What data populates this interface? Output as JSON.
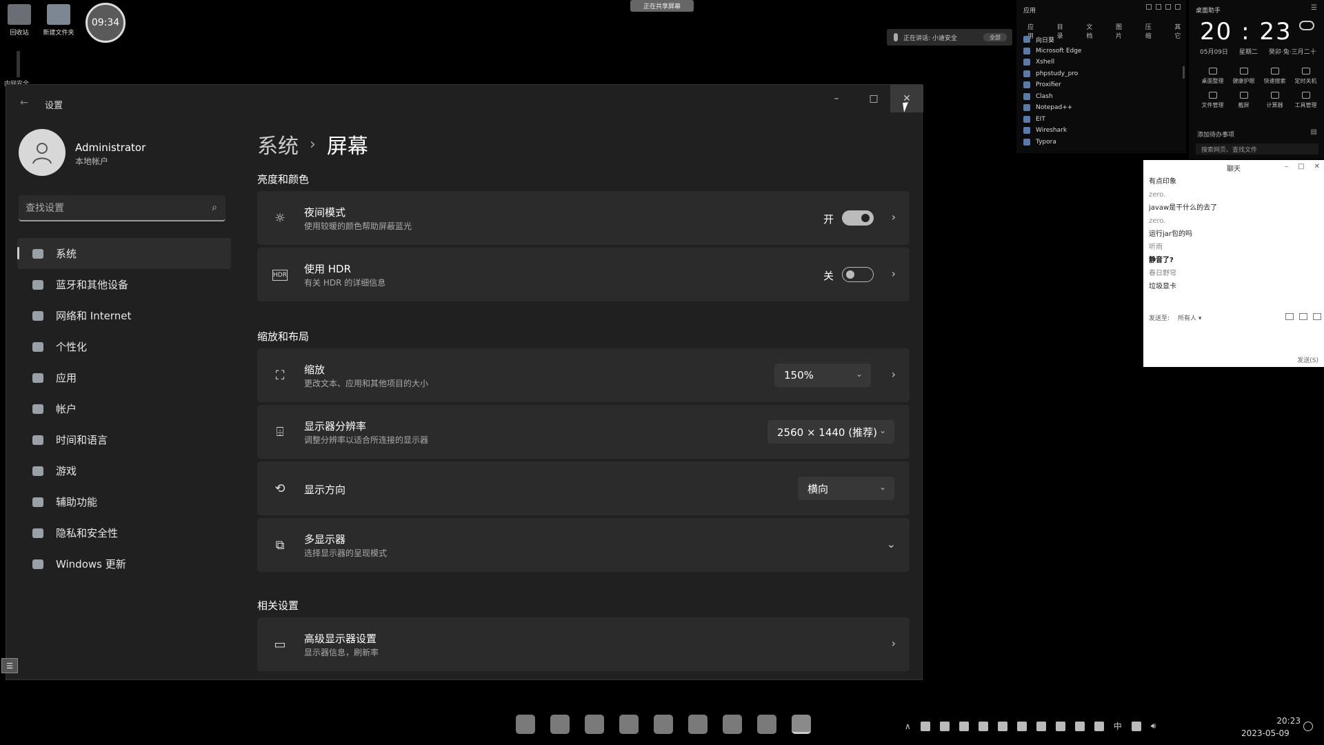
{
  "desktop": {
    "icons": [
      {
        "label": "回收站",
        "icon": "recycle-bin-icon"
      },
      {
        "label": "新建文件夹",
        "icon": "folder-icon"
      }
    ],
    "clock_bubble": "09:34",
    "top_pill": "正在共享屏幕",
    "speech_bar": {
      "text": "正在讲话: 小迪安全",
      "pill": "全部"
    },
    "left_text": "内网安全"
  },
  "launcher": {
    "title": "应用",
    "tabs": [
      "应用",
      "目录",
      "文档",
      "图片",
      "压缩",
      "其它"
    ],
    "items": [
      "向日葵",
      "Microsoft Edge",
      "Xshell",
      "phpstudy_pro",
      "Proxifier",
      "Clash",
      "Notepad++",
      "EIT",
      "Wireshark",
      "Typora"
    ]
  },
  "assistant": {
    "title": "桌面助手",
    "time": "20 : 23",
    "date": "05月09日",
    "weekday": "星期二",
    "lunar": "癸卯·兔·三月二十",
    "tools": [
      "桌面整理",
      "健康护眼",
      "快速搜索",
      "定时关机",
      "文件管理",
      "截屏",
      "计算器",
      "工具管理"
    ],
    "todo": "添加待办事项",
    "search_placeholder": "搜索网页、查找文件"
  },
  "chat": {
    "title": "聊天",
    "messages": [
      {
        "text": "有点印象",
        "style": "normal"
      },
      {
        "text": "zero.",
        "style": "name"
      },
      {
        "text": "javaw是干什么的去了",
        "style": "normal"
      },
      {
        "text": "zero.",
        "style": "name"
      },
      {
        "text": "运行jar包的吗",
        "style": "normal"
      },
      {
        "text": "听雨",
        "style": "name"
      },
      {
        "text": "静音了?",
        "style": "bold"
      },
      {
        "text": "春日野穹",
        "style": "name"
      },
      {
        "text": "垃圾显卡",
        "style": "normal"
      }
    ],
    "send_to_label": "发送至:",
    "send_to_value": "所有人 ▾",
    "send_button": "发送(S)"
  },
  "settings": {
    "window_title": "设置",
    "user": {
      "name": "Administrator",
      "type": "本地帐户"
    },
    "search_placeholder": "查找设置",
    "nav": [
      {
        "label": "系统",
        "icon": "monitor-icon",
        "selected": true
      },
      {
        "label": "蓝牙和其他设备",
        "icon": "bluetooth-icon"
      },
      {
        "label": "网络和 Internet",
        "icon": "wifi-icon"
      },
      {
        "label": "个性化",
        "icon": "brush-icon"
      },
      {
        "label": "应用",
        "icon": "apps-icon"
      },
      {
        "label": "帐户",
        "icon": "person-icon"
      },
      {
        "label": "时间和语言",
        "icon": "globe-clock-icon"
      },
      {
        "label": "游戏",
        "icon": "gamepad-icon"
      },
      {
        "label": "辅助功能",
        "icon": "accessibility-icon"
      },
      {
        "label": "隐私和安全性",
        "icon": "shield-icon"
      },
      {
        "label": "Windows 更新",
        "icon": "update-icon"
      }
    ],
    "breadcrumb": {
      "parent": "系统",
      "sep": "›",
      "current": "屏幕"
    },
    "sections": {
      "brightness": "亮度和颜色",
      "scale": "缩放和布局",
      "related": "相关设置"
    },
    "night_light": {
      "title": "夜间模式",
      "sub": "使用较暖的颜色帮助屏蔽蓝光",
      "state": "开"
    },
    "hdr": {
      "title": "使用 HDR",
      "sub": "有关 HDR 的详细信息",
      "state": "关"
    },
    "zoom": {
      "title": "缩放",
      "sub": "更改文本、应用和其他项目的大小",
      "value": "150%"
    },
    "resolution": {
      "title": "显示器分辨率",
      "sub": "调整分辨率以适合所连接的显示器",
      "value": "2560 × 1440 (推荐)"
    },
    "orientation": {
      "title": "显示方向",
      "value": "横向"
    },
    "multi": {
      "title": "多显示器",
      "sub": "选择显示器的呈现模式"
    },
    "advanced": {
      "title": "高级显示器设置",
      "sub": "显示器信息，刷新率"
    }
  },
  "taskbar": {
    "time": "20:23",
    "date": "2023-05-09",
    "ime": "中"
  }
}
